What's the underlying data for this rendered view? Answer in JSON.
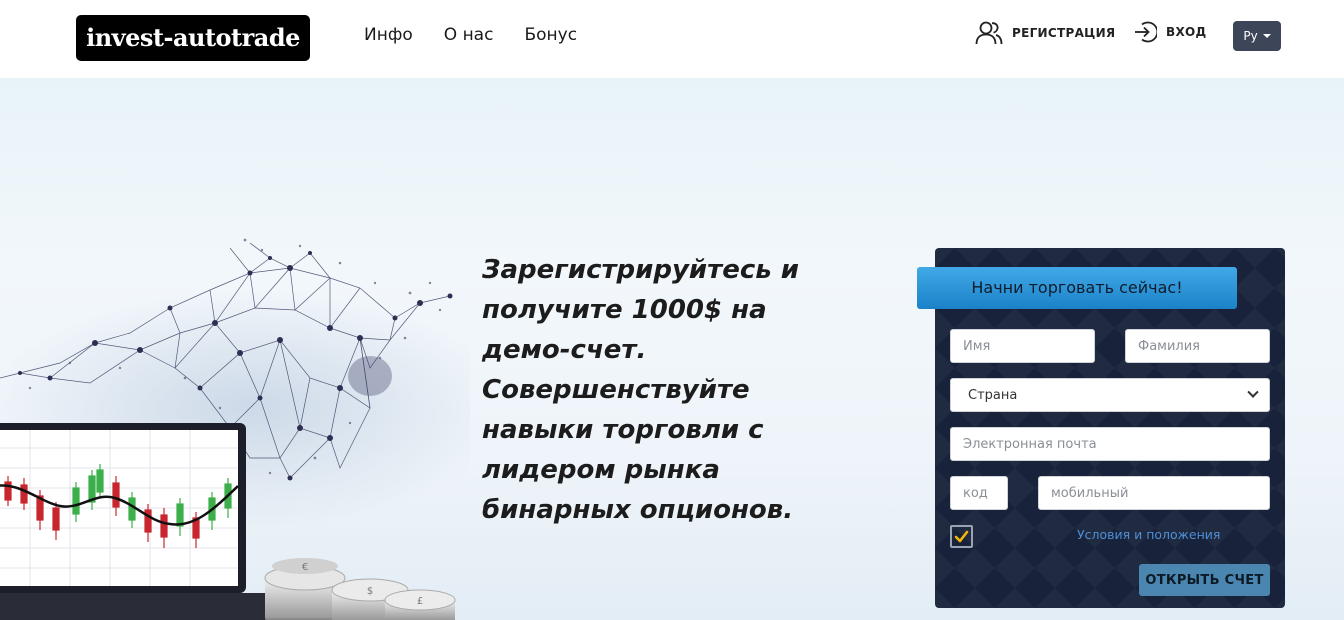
{
  "header": {
    "logo_text": "invest-autotrade",
    "nav": [
      "Инфо",
      "О нас",
      "Бонус"
    ],
    "register_label": "РЕГИСТРАЦИЯ",
    "login_label": "ВХОД",
    "language": "Ру"
  },
  "hero": {
    "headline": "Зарегистрируйтесь и получите 1000$ на демо-счет. Совершенствуйте навыки торговли с лидером рынка бинарных опционов."
  },
  "form": {
    "title": "Начни торговать сейчас!",
    "first_name_placeholder": "Имя",
    "last_name_placeholder": "Фамилия",
    "country_selected": "Страна",
    "email_placeholder": "Электронная почта",
    "code_placeholder": "код",
    "phone_placeholder": "мобильный",
    "terms_label": "Условия и положения",
    "terms_checked": true,
    "submit_label": "ОТКРЫТЬ СЧЕТ"
  },
  "colors": {
    "panel_bg": "#18223a",
    "title_bar": "#2a95d8",
    "submit_bg": "#4a86b0",
    "checkmark": "#f5b700",
    "link": "#4d90d6",
    "candle_up": "#3cae4a",
    "candle_down": "#c8262f"
  },
  "icons": {
    "register": "users-icon",
    "login": "sign-in-icon",
    "language_caret": "caret-down-icon",
    "checkbox": "checkmark-icon"
  }
}
